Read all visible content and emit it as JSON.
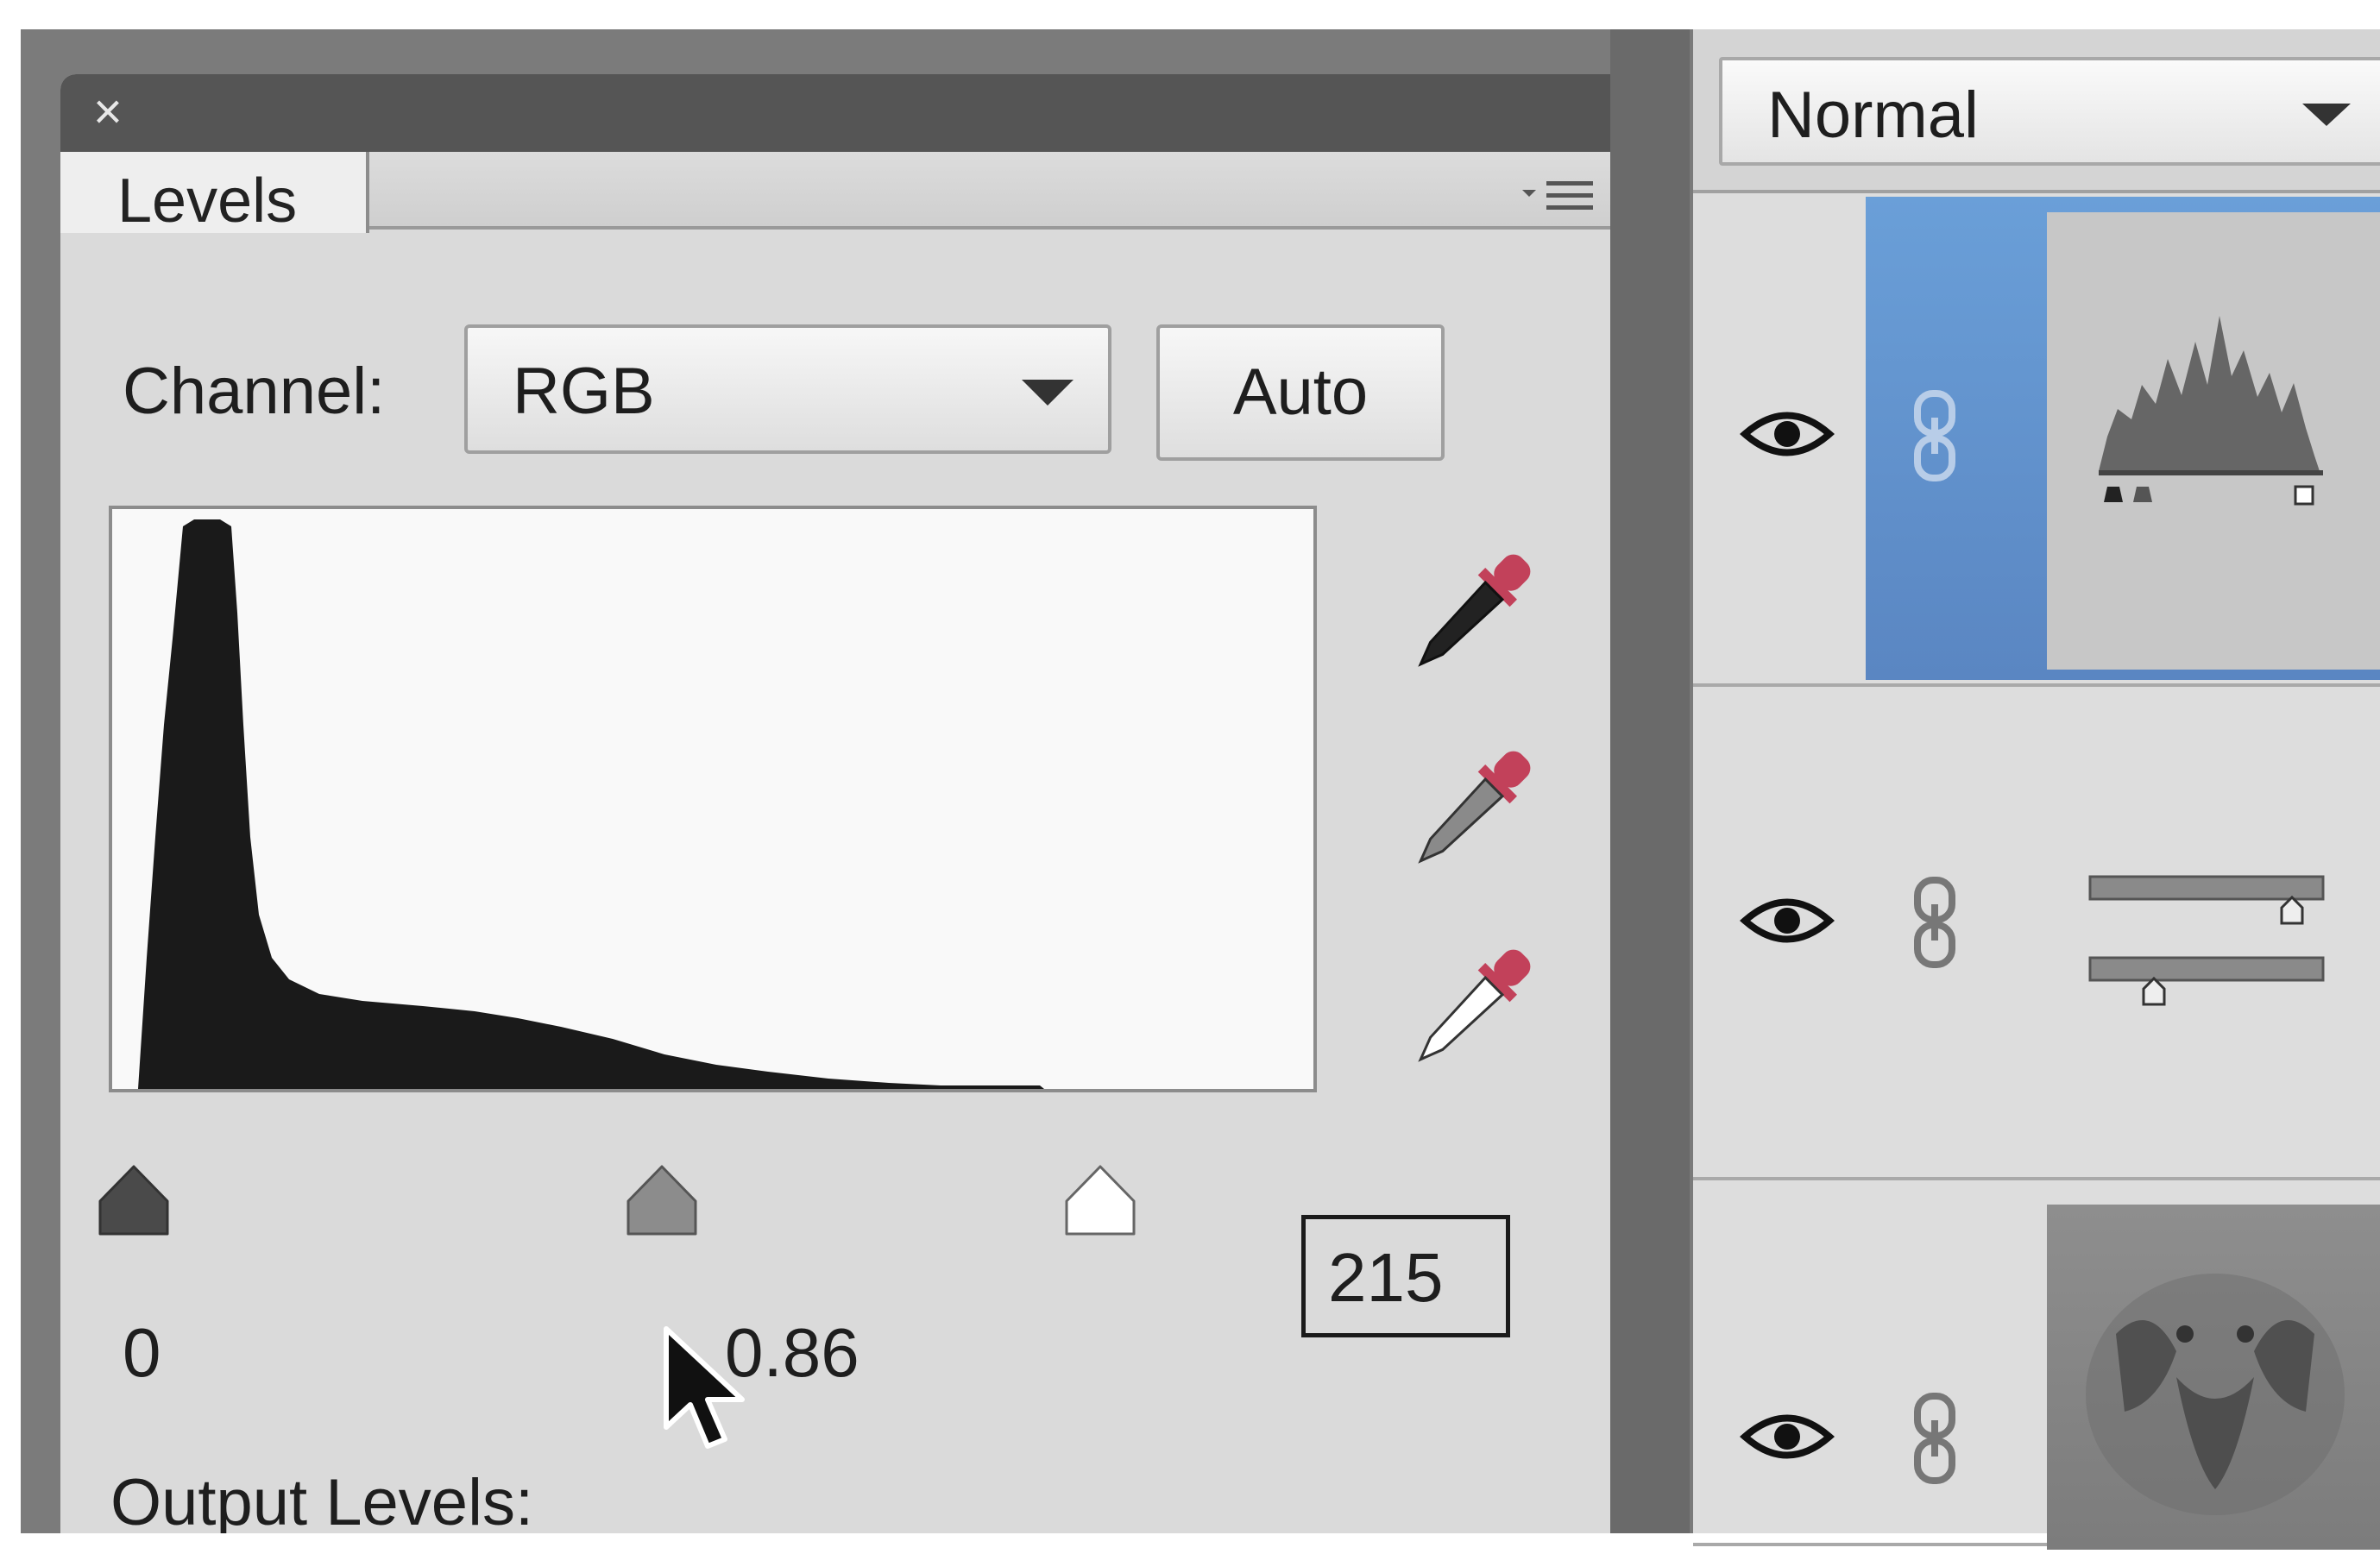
{
  "panel": {
    "close_label": "×",
    "tab_label": "Levels",
    "menu_icon": "panel-menu-icon"
  },
  "channel": {
    "label": "Channel:",
    "value": "RGB"
  },
  "auto_button": "Auto",
  "input_levels": {
    "black": "0",
    "gamma": "0.86",
    "white": "215"
  },
  "output_levels": {
    "label": "Output Levels:"
  },
  "layers": {
    "blend_mode": "Normal"
  },
  "colors": {
    "panel_bg": "#dadada",
    "selected_layer": "#5f93d2",
    "dropper_red": "#c2415a"
  }
}
